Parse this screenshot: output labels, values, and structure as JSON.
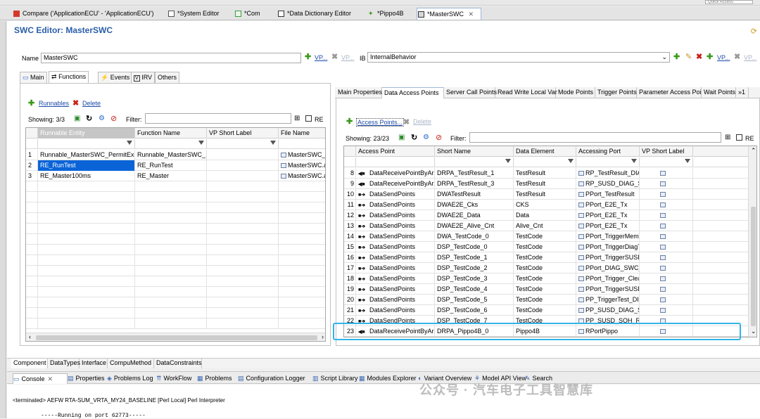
{
  "quick_access": "Quick Access",
  "editor_tabs": [
    {
      "label": "Compare ('ApplicationECU' - 'ApplicationECU')"
    },
    {
      "label": "*System Editor"
    },
    {
      "label": "*Com"
    },
    {
      "label": "*Data Dictionary Editor"
    },
    {
      "label": "*Pippo4B"
    },
    {
      "label": "*MasterSWC"
    }
  ],
  "editor": {
    "title": "SWC Editor: MasterSWC",
    "name_label": "Name",
    "name_value": "MasterSWC",
    "vp_label": "VP...",
    "ib_label": "IB",
    "ib_value": "InternalBehavior"
  },
  "sub_tabs": [
    "Main",
    "Functions",
    "Events",
    "IRV",
    "Others"
  ],
  "left_panel": {
    "runnables_label": "Runnables",
    "delete_label": "Delete",
    "showing": "Showing: 3/3",
    "filter_label": "Filter:",
    "re_label": "RE",
    "columns": [
      "Runnable Entity",
      "Function Name",
      "VP Short Label",
      "File Name"
    ],
    "rows": [
      {
        "num": "1",
        "runnable": "Runnable_MasterSWC_PermitEx...",
        "function": "Runnable_MasterSWC_...",
        "vp": "",
        "file": "MasterSWC_SUSD"
      },
      {
        "num": "2",
        "runnable": "RE_RunTest",
        "function": "RE_RunTest",
        "vp": "",
        "file": "MasterSWC.arxml"
      },
      {
        "num": "3",
        "runnable": "RE_Master100ms",
        "function": "RE_Master",
        "vp": "",
        "file": "MasterSWC.arxml"
      }
    ]
  },
  "right_tabs": [
    "Main Properties",
    "Data Access Points",
    "Server Call Points",
    "Read Write Local Var",
    "Mode Points",
    "Trigger Points",
    "Parameter Access Poi",
    "Wait Points",
    "»1"
  ],
  "right_panel": {
    "access_points_label": "Access Points...",
    "delete_label": "Delete",
    "showing": "Showing: 23/23",
    "filter_label": "Filter:",
    "re_label": "RE",
    "columns": [
      "Access Point",
      "Short Name",
      "Data Element",
      "Accessing Port",
      "VP Short Label"
    ],
    "rows": [
      {
        "num": "8",
        "dir": "recv",
        "access": "DataReceivePointByAr...",
        "short": "DRPA_TestResult_1",
        "element": "TestResult",
        "port": "RP_TestResult_DIAG_..."
      },
      {
        "num": "9",
        "dir": "recv",
        "access": "DataReceivePointByAr...",
        "short": "DRPA_TestResult_3",
        "element": "TestResult",
        "port": "RP_SUSD_DIAG_SOH..."
      },
      {
        "num": "10",
        "dir": "send",
        "access": "DataSendPoints",
        "short": "DWATestResult",
        "element": "TestResult",
        "port": "PPort_TestResult"
      },
      {
        "num": "11",
        "dir": "send",
        "access": "DataSendPoints",
        "short": "DWAE2E_Cks",
        "element": "CKS",
        "port": "PPort_E2E_Tx"
      },
      {
        "num": "12",
        "dir": "send",
        "access": "DataSendPoints",
        "short": "DWAE2E_Data",
        "element": "Data",
        "port": "PPort_E2E_Tx"
      },
      {
        "num": "13",
        "dir": "send",
        "access": "DataSendPoints",
        "short": "DWAE2E_Alive_Cnt",
        "element": "Alive_Cnt",
        "port": "PPort_E2E_Tx"
      },
      {
        "num": "14",
        "dir": "send",
        "access": "DataSendPoints",
        "short": "DWA_TestCode_0",
        "element": "TestCode",
        "port": "PPort_TriggerMemTest"
      },
      {
        "num": "15",
        "dir": "send",
        "access": "DataSendPoints",
        "short": "DSP_TestCode_0",
        "element": "TestCode",
        "port": "PPort_TriggerDiagTest"
      },
      {
        "num": "16",
        "dir": "send",
        "access": "DataSendPoints",
        "short": "DSP_TestCode_1",
        "element": "TestCode",
        "port": "PPort_TriggerSUSDB..."
      },
      {
        "num": "17",
        "dir": "send",
        "access": "DataSendPoints",
        "short": "DSP_TestCode_2",
        "element": "TestCode",
        "port": "PPort_DIAG_SWC_Tri..."
      },
      {
        "num": "18",
        "dir": "send",
        "access": "DataSendPoints",
        "short": "DSP_TestCode_3",
        "element": "TestCode",
        "port": "PPort_Trigger_Clear..."
      },
      {
        "num": "19",
        "dir": "send",
        "access": "DataSendPoints",
        "short": "DSP_TestCode_4",
        "element": "TestCode",
        "port": "PPort_TriggerSUSD_..."
      },
      {
        "num": "20",
        "dir": "send",
        "access": "DataSendPoints",
        "short": "DSP_TestCode_5",
        "element": "TestCode",
        "port": "PP_TriggerTest_DIAG..."
      },
      {
        "num": "21",
        "dir": "send",
        "access": "DataSendPoints",
        "short": "DSP_TestCode_6",
        "element": "TestCode",
        "port": "PP_SUSD_DIAG_SOH..."
      },
      {
        "num": "22",
        "dir": "send",
        "access": "DataSendPoints",
        "short": "DSP_TestCode_7",
        "element": "TestCode",
        "port": "PP_SUSD_SOH_Reset..."
      },
      {
        "num": "23",
        "dir": "recv",
        "access": "DataReceivePointByAr...",
        "short": "DRPA_Pippo4B_0",
        "element": "Pippo4B",
        "port": "RPortPippo"
      }
    ]
  },
  "bottom_tabs": [
    "Component",
    "DataTypes",
    "Interface",
    "CompuMethod",
    "DataConstraints"
  ],
  "console_tabs": [
    "Console",
    "Properties",
    "Problems Log",
    "WorkFlow",
    "Problems",
    "Configuration Logger",
    "Script Library",
    "Modules Explorer",
    "Variant Overview",
    "Model API View",
    "Search"
  ],
  "console": {
    "terminated": "<terminated> AEFW RTA-SUM_VRTA_MY24_BASELINE [Perl Local] Perl Interpreter",
    "line": "-----Running on port 62773-----"
  },
  "watermark": "公众号 · 汽车电子工具智慧库",
  "colors": {
    "title": "#2a5ea8",
    "selection": "#0a64d8",
    "highlight": "#33b4e8"
  }
}
